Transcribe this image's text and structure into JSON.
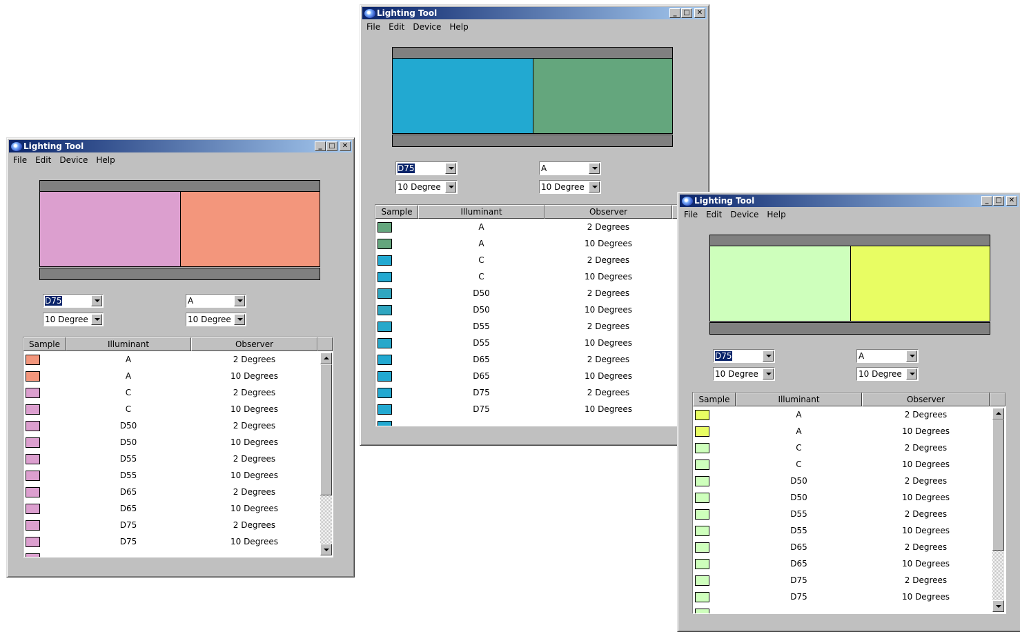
{
  "windows": [
    {
      "title": "Lighting Tool",
      "menu": [
        "File",
        "Edit",
        "Device",
        "Help"
      ],
      "swatch_left": "#dc9fcf",
      "swatch_right": "#f3967c",
      "combo1": {
        "value": "D75"
      },
      "combo2": {
        "value": "10 Degree"
      },
      "combo3": {
        "value": "A"
      },
      "combo4": {
        "value": "10 Degree"
      },
      "columns": [
        "Sample",
        "Illuminant",
        "Observer"
      ],
      "rows": [
        {
          "color": "#f3967c",
          "illuminant": "A",
          "observer": "2 Degrees"
        },
        {
          "color": "#f3967c",
          "illuminant": "A",
          "observer": "10 Degrees"
        },
        {
          "color": "#dc9fcf",
          "illuminant": "C",
          "observer": "2 Degrees"
        },
        {
          "color": "#dc9fcf",
          "illuminant": "C",
          "observer": "10 Degrees"
        },
        {
          "color": "#dc9fcf",
          "illuminant": "D50",
          "observer": "2 Degrees"
        },
        {
          "color": "#dc9fcf",
          "illuminant": "D50",
          "observer": "10 Degrees"
        },
        {
          "color": "#dc9fcf",
          "illuminant": "D55",
          "observer": "2 Degrees"
        },
        {
          "color": "#dc9fcf",
          "illuminant": "D55",
          "observer": "10 Degrees"
        },
        {
          "color": "#dc9fcf",
          "illuminant": "D65",
          "observer": "2 Degrees"
        },
        {
          "color": "#dc9fcf",
          "illuminant": "D65",
          "observer": "10 Degrees"
        },
        {
          "color": "#dc9fcf",
          "illuminant": "D75",
          "observer": "2 Degrees"
        },
        {
          "color": "#dc9fcf",
          "illuminant": "D75",
          "observer": "10 Degrees"
        }
      ]
    },
    {
      "title": "Lighting Tool",
      "menu": [
        "File",
        "Edit",
        "Device",
        "Help"
      ],
      "swatch_left": "#22a9d1",
      "swatch_right": "#64a67d",
      "combo1": {
        "value": "D75"
      },
      "combo2": {
        "value": "10 Degree"
      },
      "combo3": {
        "value": "A"
      },
      "combo4": {
        "value": "10 Degree"
      },
      "columns": [
        "Sample",
        "Illuminant",
        "Observer"
      ],
      "rows": [
        {
          "color": "#64a67d",
          "illuminant": "A",
          "observer": "2 Degrees"
        },
        {
          "color": "#64a67d",
          "illuminant": "A",
          "observer": "10 Degrees"
        },
        {
          "color": "#22a9d1",
          "illuminant": "C",
          "observer": "2 Degrees"
        },
        {
          "color": "#22a9d1",
          "illuminant": "C",
          "observer": "10 Degrees"
        },
        {
          "color": "#2fa6c0",
          "illuminant": "D50",
          "observer": "2 Degrees"
        },
        {
          "color": "#2fa6c0",
          "illuminant": "D50",
          "observer": "10 Degrees"
        },
        {
          "color": "#27a8ca",
          "illuminant": "D55",
          "observer": "2 Degrees"
        },
        {
          "color": "#27a8ca",
          "illuminant": "D55",
          "observer": "10 Degrees"
        },
        {
          "color": "#22a9d1",
          "illuminant": "D65",
          "observer": "2 Degrees"
        },
        {
          "color": "#22a9d1",
          "illuminant": "D65",
          "observer": "10 Degrees"
        },
        {
          "color": "#22a9d1",
          "illuminant": "D75",
          "observer": "2 Degrees"
        },
        {
          "color": "#22a9d1",
          "illuminant": "D75",
          "observer": "10 Degrees"
        }
      ]
    },
    {
      "title": "Lighting Tool",
      "menu": [
        "File",
        "Edit",
        "Device",
        "Help"
      ],
      "swatch_left": "#ceffbc",
      "swatch_right": "#e8fd63",
      "combo1": {
        "value": "D75"
      },
      "combo2": {
        "value": "10 Degree"
      },
      "combo3": {
        "value": "A"
      },
      "combo4": {
        "value": "10 Degree"
      },
      "columns": [
        "Sample",
        "Illuminant",
        "Observer"
      ],
      "rows": [
        {
          "color": "#e8fd63",
          "illuminant": "A",
          "observer": "2 Degrees"
        },
        {
          "color": "#e8fd63",
          "illuminant": "A",
          "observer": "10 Degrees"
        },
        {
          "color": "#ceffbc",
          "illuminant": "C",
          "observer": "2 Degrees"
        },
        {
          "color": "#ceffbc",
          "illuminant": "C",
          "observer": "10 Degrees"
        },
        {
          "color": "#ceffbc",
          "illuminant": "D50",
          "observer": "2 Degrees"
        },
        {
          "color": "#ceffbc",
          "illuminant": "D50",
          "observer": "10 Degrees"
        },
        {
          "color": "#ceffbc",
          "illuminant": "D55",
          "observer": "2 Degrees"
        },
        {
          "color": "#ceffbc",
          "illuminant": "D55",
          "observer": "10 Degrees"
        },
        {
          "color": "#ceffbc",
          "illuminant": "D65",
          "observer": "2 Degrees"
        },
        {
          "color": "#ceffbc",
          "illuminant": "D65",
          "observer": "10 Degrees"
        },
        {
          "color": "#ceffbc",
          "illuminant": "D75",
          "observer": "2 Degrees"
        },
        {
          "color": "#ceffbc",
          "illuminant": "D75",
          "observer": "10 Degrees"
        }
      ]
    }
  ]
}
